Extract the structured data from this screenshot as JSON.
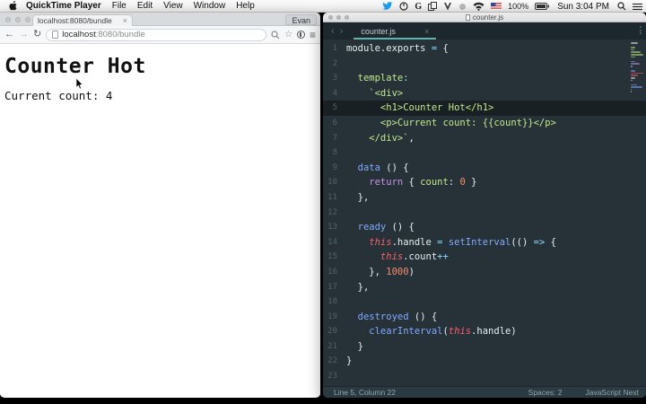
{
  "menubar": {
    "app_name": "QuickTime Player",
    "menus": [
      "File",
      "Edit",
      "View",
      "Window",
      "Help"
    ],
    "status_icons": [
      "twitter-icon",
      "recording-icon",
      "g-app-icon",
      "windows-app-icon",
      "mask-app-icon",
      "sync-icon",
      "wifi-icon",
      "input-flag-icon"
    ],
    "battery_percent": "100%",
    "clock": "Sun 3:04 PM"
  },
  "icons": {
    "close": "×",
    "back": "←",
    "forward": "→",
    "refresh": "↻",
    "star": "☆",
    "hamburger": "≡",
    "chevron_left": "‹",
    "chevron_right": "›"
  },
  "browser": {
    "tab_title": "localhost:8080/bundle",
    "profile": "Evan",
    "url_host": "localhost",
    "url_rest": ":8080/bundle",
    "page": {
      "heading": "Counter Hot",
      "body_text": "Current count: 4"
    }
  },
  "editor": {
    "window_title": "counter.js",
    "tab_label": "counter.js",
    "active_line": 5,
    "status": {
      "position": "Line 5, Column 22",
      "indent": "Spaces: 2",
      "syntax": "JavaScript Next"
    },
    "code": {
      "lines": [
        {
          "n": 1,
          "t": [
            [
              "w",
              "module.exports "
            ],
            [
              "c",
              "="
            ],
            [
              "w",
              " {"
            ]
          ]
        },
        {
          "n": 2,
          "t": []
        },
        {
          "n": 3,
          "t": [
            [
              "g",
              "  template"
            ],
            [
              "c",
              ":"
            ]
          ]
        },
        {
          "n": 4,
          "t": [
            [
              "g",
              "    `<div>"
            ]
          ]
        },
        {
          "n": 5,
          "t": [
            [
              "g",
              "      <h1>Counter Hot</h1>"
            ]
          ]
        },
        {
          "n": 6,
          "t": [
            [
              "g",
              "      <p>Current count: {{count}}</p>"
            ]
          ]
        },
        {
          "n": 7,
          "t": [
            [
              "g",
              "    </div>`"
            ],
            [
              "w",
              ","
            ]
          ]
        },
        {
          "n": 8,
          "t": []
        },
        {
          "n": 9,
          "t": [
            [
              "b",
              "  data"
            ],
            [
              "w",
              " () {"
            ]
          ]
        },
        {
          "n": 10,
          "t": [
            [
              "p",
              "    return"
            ],
            [
              "w",
              " { "
            ],
            [
              "g",
              "count"
            ],
            [
              "w",
              ": "
            ],
            [
              "o",
              "0"
            ],
            [
              "w",
              " }"
            ]
          ]
        },
        {
          "n": 11,
          "t": [
            [
              "w",
              "  },"
            ]
          ]
        },
        {
          "n": 12,
          "t": []
        },
        {
          "n": 13,
          "t": [
            [
              "b",
              "  ready"
            ],
            [
              "w",
              " () {"
            ]
          ]
        },
        {
          "n": 14,
          "t": [
            [
              "r",
              "    this"
            ],
            [
              "w",
              ".handle "
            ],
            [
              "c",
              "="
            ],
            [
              "w",
              " "
            ],
            [
              "b",
              "setInterval"
            ],
            [
              "w",
              "(() "
            ],
            [
              "c",
              "=>"
            ],
            [
              "w",
              " {"
            ]
          ]
        },
        {
          "n": 15,
          "t": [
            [
              "r",
              "      this"
            ],
            [
              "w",
              ".count"
            ],
            [
              "c",
              "++"
            ]
          ]
        },
        {
          "n": 16,
          "t": [
            [
              "w",
              "    }, "
            ],
            [
              "o",
              "1000"
            ],
            [
              "w",
              ")"
            ]
          ]
        },
        {
          "n": 17,
          "t": [
            [
              "w",
              "  },"
            ]
          ]
        },
        {
          "n": 18,
          "t": []
        },
        {
          "n": 19,
          "t": [
            [
              "b",
              "  destroyed"
            ],
            [
              "w",
              " () {"
            ]
          ]
        },
        {
          "n": 20,
          "t": [
            [
              "b",
              "    clearInterval"
            ],
            [
              "w",
              "("
            ],
            [
              "r",
              "this"
            ],
            [
              "w",
              ".handle)"
            ]
          ]
        },
        {
          "n": 21,
          "t": [
            [
              "w",
              "  }"
            ]
          ]
        },
        {
          "n": 22,
          "t": [
            [
              "w",
              "}"
            ]
          ]
        },
        {
          "n": 23,
          "t": []
        }
      ]
    }
  },
  "colors": {
    "editor_bg": "#263238",
    "accent_teal": "#5fb3ac",
    "string_green": "#c3e88d",
    "function_blue": "#82aaff",
    "keyword_purple": "#c792ea",
    "number_orange": "#f78c6c",
    "this_red": "#ff5d6e",
    "operator_cyan": "#89ddff",
    "twitter_blue": "#1da1f2"
  }
}
